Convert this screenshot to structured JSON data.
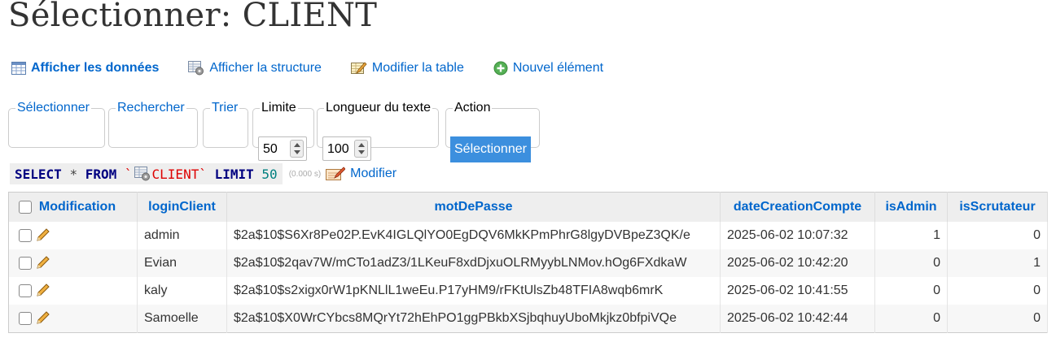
{
  "title": "Sélectionner: CLIENT",
  "nav": [
    {
      "label": "Afficher les données",
      "icon": "table-icon"
    },
    {
      "label": "Afficher la structure",
      "icon": "structure-icon"
    },
    {
      "label": "Modifier la table",
      "icon": "edit-table-icon"
    },
    {
      "label": "Nouvel élément",
      "icon": "plus-circle-icon"
    }
  ],
  "form": {
    "select_label": "Sélectionner",
    "search_label": "Rechercher",
    "sort_label": "Trier",
    "limit_label": "Limite",
    "limit_value": "50",
    "textlen_label": "Longueur du texte",
    "textlen_value": "100",
    "action_label": "Action",
    "action_button": "Sélectionner"
  },
  "query": {
    "select": "SELECT",
    "star": "*",
    "from": "FROM",
    "table": "CLIENT",
    "limit": "LIMIT",
    "limit_value": "50",
    "time": "(0.000 s)",
    "modify_label": "Modifier"
  },
  "table": {
    "columns": [
      "Modification",
      "loginClient",
      "motDePasse",
      "dateCreationCompte",
      "isAdmin",
      "isScrutateur"
    ],
    "rows": [
      [
        "admin",
        "$2a$10$S6Xr8Pe02P.EvK4IGLQlYO0EgDQV6MkKPmPhrG8lgyDVBpeZ3QK/e",
        "2025-06-02 10:07:32",
        "1",
        "0"
      ],
      [
        "Evian",
        "$2a$10$2qav7W/mCTo1adZ3/1LKeuF8xdDjxuOLRMyybLNMov.hOg6FXdkaW",
        "2025-06-02 10:42:20",
        "0",
        "1"
      ],
      [
        "kaly",
        "$2a$10$s2xigx0rW1pKNLlL1weEu.P17yHM9/rFKtUlsZb48TFIA8wqb6mrK",
        "2025-06-02 10:41:55",
        "0",
        "0"
      ],
      [
        "Samoelle",
        "$2a$10$X0WrCYbcs8MQrYt72hEhPO1ggPBkbXSjbqhuyUboMkjkz0bfpiVQe",
        "2025-06-02 10:42:44",
        "0",
        "0"
      ]
    ]
  }
}
